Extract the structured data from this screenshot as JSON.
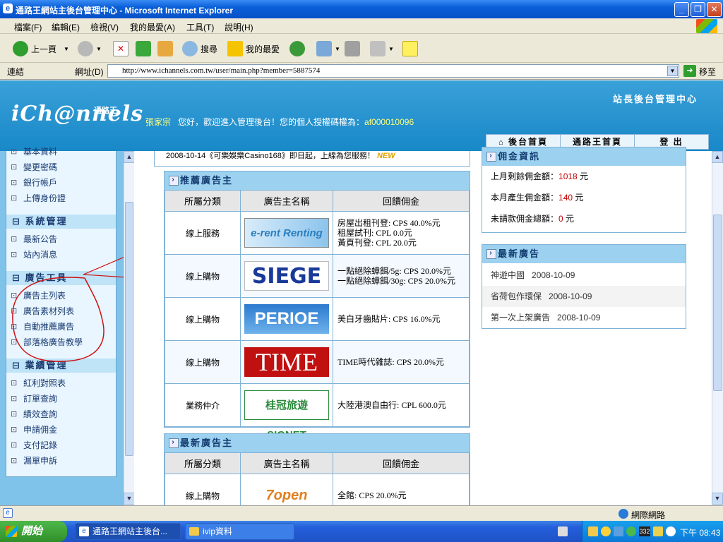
{
  "window": {
    "title": "通路王網站主後台管理中心 - Microsoft Internet Explorer",
    "min": "_",
    "max": "❐",
    "close": "✕"
  },
  "menu": [
    "檔案(F)",
    "編輯(E)",
    "檢視(V)",
    "我的最愛(A)",
    "工具(T)",
    "說明(H)"
  ],
  "toolbar": {
    "back": "上一頁",
    "search": "搜尋",
    "favorites": "我的最愛"
  },
  "address": {
    "links": "連結",
    "label": "網址(D)",
    "url": "http://www.ichannels.com.tw/user/main.php?member=5887574",
    "go": "移至"
  },
  "header": {
    "logo": "iCh@nnels",
    "logo_sub": "通路王",
    "user": "張家宗",
    "greeting": "您好，歡迎進入管理後台！您的個人授權碼權為：",
    "code": "af000010096",
    "title": "站長後台管理中心"
  },
  "topnav": [
    "後台首頁",
    "通路王首頁",
    "登 出"
  ],
  "sidebar": {
    "top_items": [
      "基本資料",
      "變更密碼",
      "銀行帳戶",
      "上傳身份證"
    ],
    "sections": [
      {
        "title": "系統管理",
        "items": [
          "最新公告",
          "站內消息"
        ]
      },
      {
        "title": "廣告工具",
        "items": [
          "廣告主列表",
          "廣告素材列表",
          "自動推薦廣告",
          "部落格廣告教學"
        ]
      },
      {
        "title": "業績管理",
        "items": [
          "紅利對照表",
          "訂單查詢",
          "績效查詢",
          "申請佣金",
          "支付記錄",
          "漏單申訴"
        ]
      }
    ]
  },
  "notice": "2008-10-14《可樂娛樂Casino168》即日起，上線為您服務！",
  "notice_badge": "NEW",
  "recommend": {
    "title": "推薦廣告主",
    "headers": [
      "所屬分類",
      "廣告主名稱",
      "回饋佣金"
    ],
    "rows": [
      {
        "cat": "線上服務",
        "ad": "e-rent Renting",
        "lines": [
          "房屋出租刊登: CPS 40.0%元",
          "租屋試刊: CPL 0.0元",
          "黃頁刊登: CPL 20.0元"
        ],
        "color": "#2a7fc0"
      },
      {
        "cat": "線上購物",
        "ad": "SIEGE",
        "lines": [
          "一點絕除蟑餌/5g: CPS 20.0%元",
          "一點絕除蟑餌/30g: CPS 20.0%元"
        ],
        "color": "#1a3a9a"
      },
      {
        "cat": "線上購物",
        "ad": "PERIOE",
        "lines": [
          "美白牙齒貼片: CPS 16.0%元"
        ],
        "color": "#1a68c0"
      },
      {
        "cat": "線上購物",
        "ad": "TIME",
        "lines": [
          "TIME時代雜誌: CPS 20.0%元"
        ],
        "color": "#c01010"
      },
      {
        "cat": "業務仲介",
        "ad": "桂冠旅遊 SIGNET",
        "lines": [
          "大陸港澳自由行: CPL 600.0元"
        ],
        "color": "#2a8a3a"
      }
    ]
  },
  "latest_table": {
    "title": "最新廣告主",
    "headers": [
      "所屬分類",
      "廣告主名稱",
      "回饋佣金"
    ],
    "rows": [
      {
        "cat": "線上購物",
        "ad": "7open",
        "lines": [
          "全館: CPS 20.0%元"
        ],
        "color": "#e08020"
      }
    ]
  },
  "commission": {
    "title": "佣金資訊",
    "rows": [
      {
        "label": "上月剩餘佣金額：",
        "value": "1018",
        "unit": "元"
      },
      {
        "label": "本月產生佣金額：",
        "value": "140",
        "unit": "元"
      },
      {
        "label": "未請款佣金總額：",
        "value": "0",
        "unit": "元"
      }
    ]
  },
  "latest_ads": {
    "title": "最新廣告",
    "rows": [
      {
        "name": "神遊中國",
        "date": "2008-10-09"
      },
      {
        "name": "省荷包作環保",
        "date": "2008-10-09"
      },
      {
        "name": "第一次上架廣告",
        "date": "2008-10-09"
      }
    ]
  },
  "status": {
    "zone": "網際網路"
  },
  "taskbar": {
    "start": "開始",
    "tasks": [
      "通路王網站主後台...",
      "ivip資料"
    ],
    "clock": "下午 08:43",
    "tray_num": "332"
  }
}
